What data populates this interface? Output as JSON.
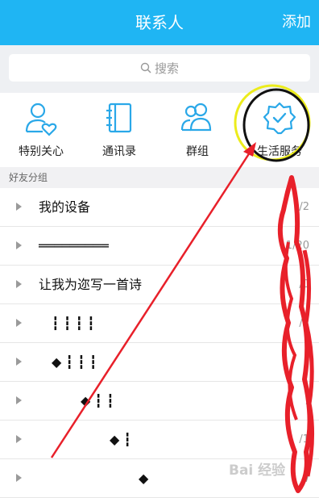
{
  "header": {
    "title": "联系人",
    "add_label": "添加"
  },
  "search": {
    "placeholder": "搜索"
  },
  "quick": [
    {
      "label": "特别关心",
      "icon": "special-care-icon"
    },
    {
      "label": "通讯录",
      "icon": "address-book-icon"
    },
    {
      "label": "群组",
      "icon": "group-icon"
    },
    {
      "label": "生活服务",
      "icon": "life-service-icon"
    }
  ],
  "section": {
    "title": "好友分组"
  },
  "groups": [
    {
      "name": "我的设备",
      "count": "/2"
    },
    {
      "name": "═════════",
      "count": "1/20"
    },
    {
      "name": "让我为迩写一首诗",
      "count": "/0"
    },
    {
      "name": "┇ ┇ ┇ ┇",
      "count": "/2"
    },
    {
      "name": "◆ ┇ ┇ ┇",
      "count": "/"
    },
    {
      "name": "◆ ┇ ┇",
      "count": "/"
    },
    {
      "name": "◆ ┇",
      "count": "/1"
    },
    {
      "name": "◆",
      "count": "/"
    }
  ],
  "watermark": "Bai 经验",
  "colors": {
    "header": "#1fb5f3",
    "icon_blue": "#2aa8e8",
    "annotation_red": "#e8202a",
    "annotation_yellow": "#ecec1c"
  }
}
